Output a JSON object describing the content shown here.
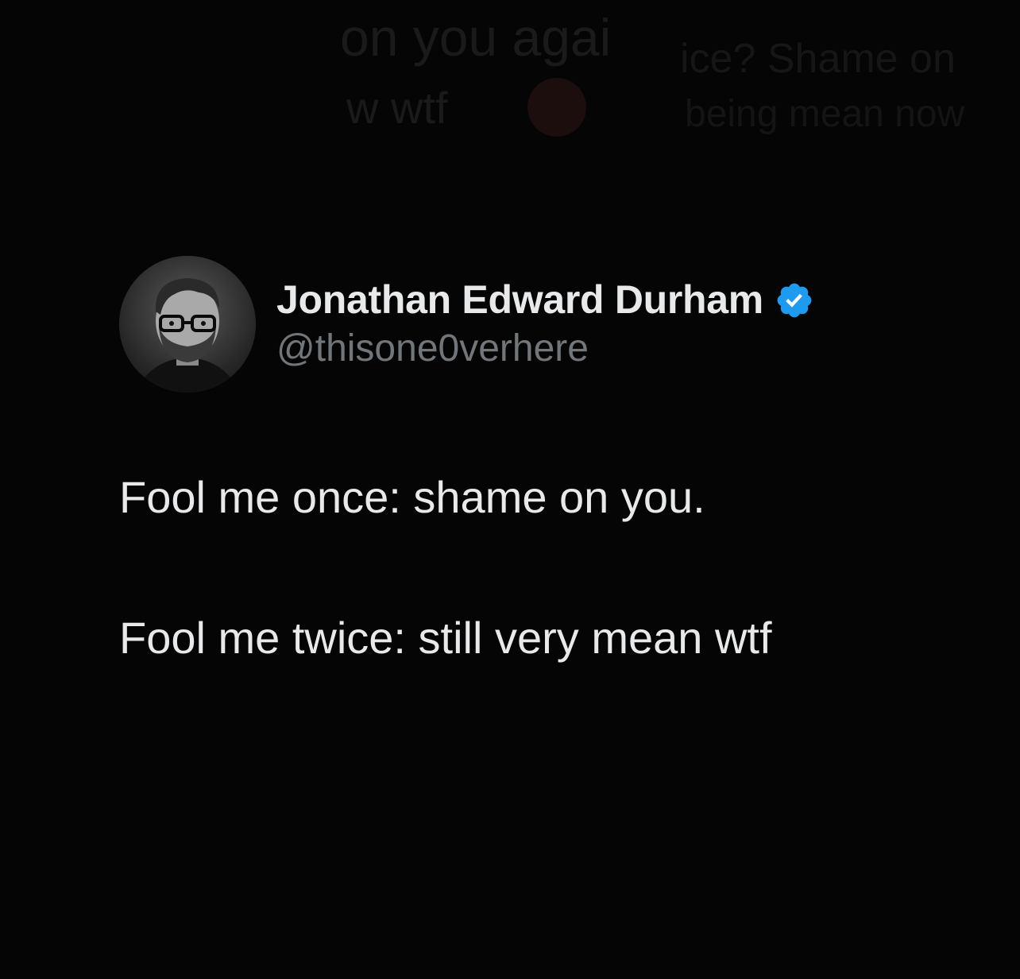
{
  "background_fragments": {
    "line1": "on you agai",
    "line2": "ice? Shame on",
    "line3": "w wtf",
    "line4": "being mean now"
  },
  "tweet": {
    "display_name": "Jonathan Edward Durham",
    "handle": "@thisone0verhere",
    "verified": true,
    "verified_color": "#1d9bf0",
    "lines": [
      "Fool me once: shame on you.",
      "Fool me twice: still very mean wtf"
    ]
  },
  "icons": {
    "verified": "verified-badge-icon",
    "avatar": "profile-photo"
  },
  "colors": {
    "background": "#000000",
    "text": "#e7e9ea",
    "muted": "#71767b",
    "accent": "#1d9bf0"
  }
}
